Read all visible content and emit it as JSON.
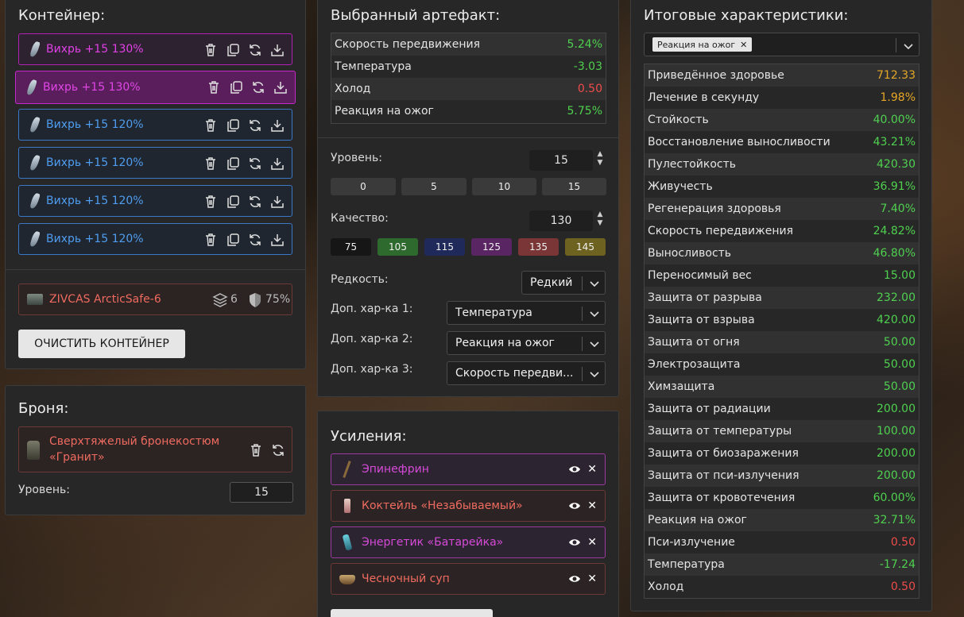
{
  "container": {
    "title": "Контейнер:",
    "items": [
      {
        "label": "Вихрь +15 130%"
      },
      {
        "label": "Вихрь +15 130%"
      },
      {
        "label": "Вихрь +15 120%"
      },
      {
        "label": "Вихрь +15 120%"
      },
      {
        "label": "Вихрь +15 120%"
      },
      {
        "label": "Вихрь +15 120%"
      }
    ],
    "case": {
      "name": "ZIVCAS ArcticSafe-6",
      "slots": "6",
      "protection": "75%"
    },
    "clear_button": "ОЧИСТИТЬ КОНТЕЙНЕР"
  },
  "armor": {
    "title": "Броня:",
    "item": "Сверхтяжелый бронекостюм «Гранит»",
    "level_label": "Уровень:",
    "level_value": "15"
  },
  "artifact": {
    "title": "Выбранный артефакт:",
    "stats": [
      {
        "name": "Скорость передвижения",
        "value": "5.24%",
        "color": "green"
      },
      {
        "name": "Температура",
        "value": "-3.03",
        "color": "green"
      },
      {
        "name": "Холод",
        "value": "0.50",
        "color": "red"
      },
      {
        "name": "Реакция на ожог",
        "value": "5.75%",
        "color": "green"
      }
    ],
    "level_label": "Уровень:",
    "level_value": "15",
    "level_presets": [
      "0",
      "5",
      "10",
      "15"
    ],
    "quality_label": "Качество:",
    "quality_value": "130",
    "quality_presets": [
      "75",
      "105",
      "115",
      "125",
      "135",
      "145"
    ],
    "rarity_label": "Редкость:",
    "rarity_value": "Редкий",
    "extra1_label": "Доп. хар-ка 1:",
    "extra1_value": "Температура",
    "extra2_label": "Доп. хар-ка 2:",
    "extra2_value": "Реакция на ожог",
    "extra3_label": "Доп. хар-ка 3:",
    "extra3_value": "Скорость передви..."
  },
  "boosts": {
    "title": "Усиления:",
    "items": [
      {
        "label": "Эпинефрин"
      },
      {
        "label": "Коктейль «Незабываемый»"
      },
      {
        "label": "Энергетик «Батарейка»"
      },
      {
        "label": "Чесночный суп"
      }
    ]
  },
  "totals": {
    "title": "Итоговые характеристики:",
    "filter_tag": "Реакция на ожог",
    "stats": [
      {
        "name": "Приведённое здоровье",
        "value": "712.33",
        "color": "yellow"
      },
      {
        "name": "Лечение в секунду",
        "value": "1.98%",
        "color": "yellow"
      },
      {
        "name": "Стойкость",
        "value": "40.00%",
        "color": "green"
      },
      {
        "name": "Восстановление выносливости",
        "value": "43.21%",
        "color": "green"
      },
      {
        "name": "Пулестойкость",
        "value": "420.30",
        "color": "green"
      },
      {
        "name": "Живучесть",
        "value": "36.91%",
        "color": "green"
      },
      {
        "name": "Регенерация здоровья",
        "value": "7.40%",
        "color": "green"
      },
      {
        "name": "Скорость передвижения",
        "value": "24.82%",
        "color": "green"
      },
      {
        "name": "Выносливость",
        "value": "46.80%",
        "color": "green"
      },
      {
        "name": "Переносимый вес",
        "value": "15.00",
        "color": "green"
      },
      {
        "name": "Защита от разрыва",
        "value": "232.00",
        "color": "green"
      },
      {
        "name": "Защита от взрыва",
        "value": "420.00",
        "color": "green"
      },
      {
        "name": "Защита от огня",
        "value": "50.00",
        "color": "green"
      },
      {
        "name": "Электрозащита",
        "value": "50.00",
        "color": "green"
      },
      {
        "name": "Химзащита",
        "value": "50.00",
        "color": "green"
      },
      {
        "name": "Защита от радиации",
        "value": "200.00",
        "color": "green"
      },
      {
        "name": "Защита от температуры",
        "value": "100.00",
        "color": "green"
      },
      {
        "name": "Защита от биозаражения",
        "value": "200.00",
        "color": "green"
      },
      {
        "name": "Защита от пси-излучения",
        "value": "200.00",
        "color": "green"
      },
      {
        "name": "Защита от кровотечения",
        "value": "60.00%",
        "color": "green"
      },
      {
        "name": "Реакция на ожог",
        "value": "32.71%",
        "color": "green"
      },
      {
        "name": "Пси-излучение",
        "value": "0.50",
        "color": "red"
      },
      {
        "name": "Температура",
        "value": "-17.24",
        "color": "green"
      },
      {
        "name": "Холод",
        "value": "0.50",
        "color": "red"
      }
    ]
  },
  "colors": {
    "green": "#4fd04f",
    "red": "#ef4b4b",
    "yellow": "#e5a727",
    "pink": "#e040e6",
    "blue": "#4f9df0"
  }
}
